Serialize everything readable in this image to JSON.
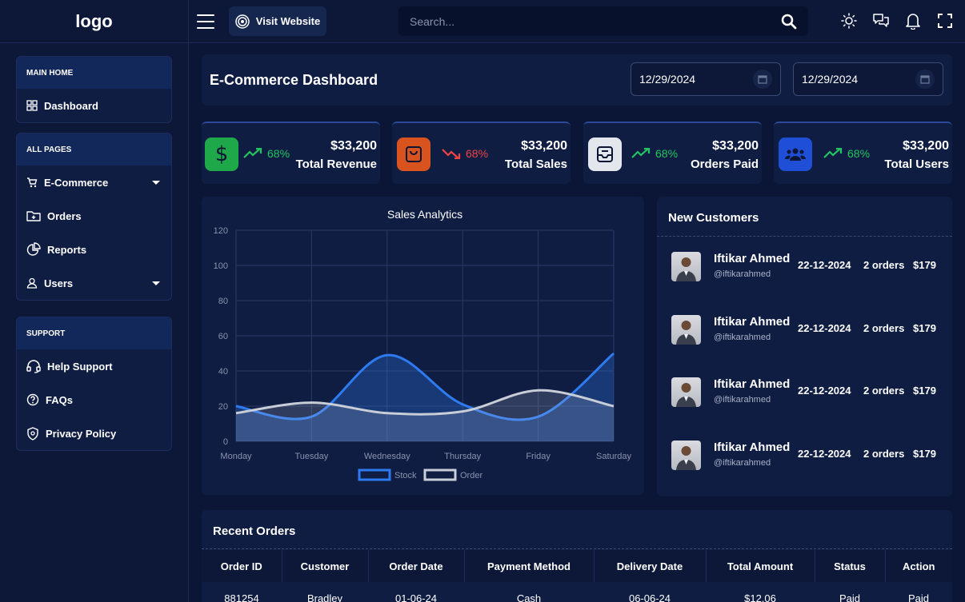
{
  "topbar": {
    "logo": "logo",
    "visit_label": "Visit Website",
    "search_placeholder": "Search...",
    "icons": [
      "hamburger-icon",
      "target-icon",
      "search-icon",
      "sun-icon",
      "chat-icon",
      "bell-icon",
      "fullscreen-icon"
    ]
  },
  "sidebar": {
    "groups": [
      {
        "title": "MAIN HOME",
        "items": [
          {
            "label": "Dashboard",
            "icon": "grid-icon"
          }
        ]
      },
      {
        "title": "ALL PAGES",
        "items": [
          {
            "label": "E-Commerce",
            "icon": "cart-icon",
            "dropdown": true
          },
          {
            "label": "Orders",
            "icon": "folder-plus-icon"
          },
          {
            "label": "Reports",
            "icon": "pie-chart-icon"
          },
          {
            "label": "Users",
            "icon": "user-icon",
            "dropdown": true
          }
        ]
      },
      {
        "title": "SUPPORT",
        "items": [
          {
            "label": "Help Support",
            "icon": "headset-icon"
          },
          {
            "label": "FAQs",
            "icon": "question-icon"
          },
          {
            "label": "Privacy Policy",
            "icon": "shield-icon"
          }
        ]
      }
    ]
  },
  "header": {
    "title": "E-Commerce Dashboard",
    "date_from": "12/29/2024",
    "date_to": "12/29/2024"
  },
  "stats": [
    {
      "value": "$33,200",
      "label": "Total Revenue",
      "trend": "68%",
      "direction": "up",
      "icon": "dollar-icon",
      "color": "#1fa84a"
    },
    {
      "value": "$33,200",
      "label": "Total Sales",
      "trend": "68%",
      "direction": "down",
      "icon": "shopping-bag-icon",
      "color": "#d9531e"
    },
    {
      "value": "$33,200",
      "label": "Orders Paid",
      "trend": "68%",
      "direction": "up",
      "icon": "inbox-icon",
      "color": "#e3e6ec"
    },
    {
      "value": "$33,200",
      "label": "Total Users",
      "trend": "68%",
      "direction": "up",
      "icon": "users-icon",
      "color": "#1f4fd6"
    }
  ],
  "chart_data": {
    "type": "area",
    "title": "Sales Analytics",
    "categories": [
      "Monday",
      "Tuesday",
      "Wednesday",
      "Thursday",
      "Friday",
      "Saturday"
    ],
    "series": [
      {
        "name": "Stock",
        "values": [
          20,
          14,
          49,
          21,
          14,
          50
        ],
        "color": "#2e7bf0"
      },
      {
        "name": "Order",
        "values": [
          16,
          22,
          16,
          17,
          29,
          20
        ],
        "color": "#c8cdd8"
      }
    ],
    "ylim": [
      0,
      120
    ],
    "yticks": [
      0,
      20,
      40,
      60,
      80,
      100,
      120
    ],
    "grid": true,
    "legend": "bottom"
  },
  "customers": {
    "title": "New Customers",
    "rows": [
      {
        "name": "Iftikar Ahmed",
        "handle": "@iftikarahmed",
        "date": "22-12-2024",
        "orders": "2 orders",
        "amount": "$179"
      },
      {
        "name": "Iftikar Ahmed",
        "handle": "@iftikarahmed",
        "date": "22-12-2024",
        "orders": "2 orders",
        "amount": "$179"
      },
      {
        "name": "Iftikar Ahmed",
        "handle": "@iftikarahmed",
        "date": "22-12-2024",
        "orders": "2 orders",
        "amount": "$179"
      },
      {
        "name": "Iftikar Ahmed",
        "handle": "@iftikarahmed",
        "date": "22-12-2024",
        "orders": "2 orders",
        "amount": "$179"
      }
    ]
  },
  "orders": {
    "title": "Recent Orders",
    "columns": [
      "Order ID",
      "Customer",
      "Order Date",
      "Payment Method",
      "Delivery Date",
      "Total Amount",
      "Status",
      "Action"
    ],
    "rows": [
      [
        "881254",
        "Bradley",
        "01-06-24",
        "Cash",
        "06-06-24",
        "$12.06",
        "Paid",
        "Paid"
      ]
    ]
  },
  "colors": {
    "up": "#22c55e",
    "down": "#ef4444"
  }
}
